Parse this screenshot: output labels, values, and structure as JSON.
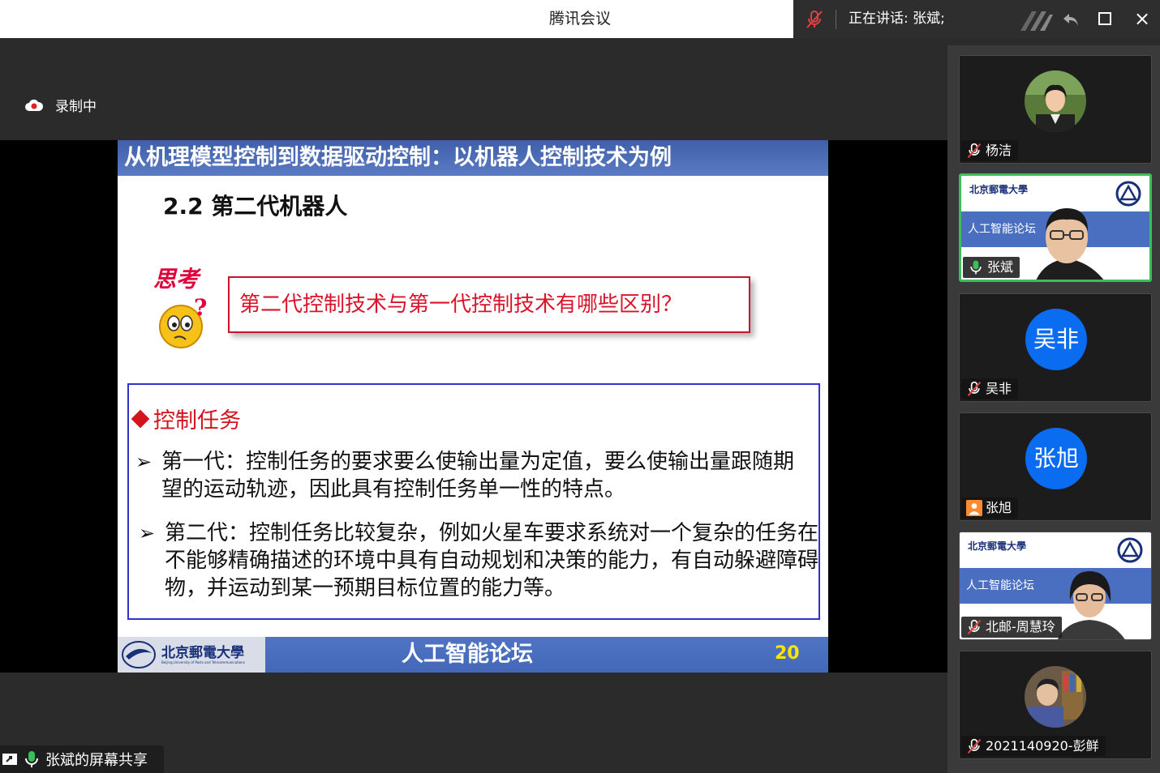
{
  "window": {
    "app_title": "腾讯会议",
    "speaking_label": "正在讲话: 张斌;"
  },
  "recording": {
    "label": "录制中"
  },
  "slide": {
    "header": "从机理模型控制到数据驱动控制：以机器人控制技术为例",
    "section": "2.2 第二代机器人",
    "think_label": "思考",
    "question": "第二代控制技术与第一代控制技术有哪些区别？",
    "task_title": "控制任务",
    "bullet1": "第一代：控制任务的要求要么使输出量为定值，要么使输出量跟随期望的运动轨迹，因此具有控制任务单一性的特点。",
    "bullet2": "第二代：控制任务比较复杂，例如火星车要求系统对一个复杂的任务在不能够精确描述的环境中具有自动规划和决策的能力，有自动躲避障碍物，并运动到某一预期目标位置的能力等。",
    "footer_logo": "北京郵電大學",
    "footer_logo_en": "Beijing University of Posts and Telecommunications",
    "footer_title": "人工智能论坛",
    "page_number": "20"
  },
  "share_badge": {
    "label": "张斌的屏幕共享"
  },
  "participants": [
    {
      "name": "杨洁",
      "type": "photo",
      "mic": "muted"
    },
    {
      "name": "张斌",
      "type": "camera",
      "mic": "active",
      "band_text": "人工智能论坛",
      "logo": "北京郵電大學"
    },
    {
      "name": "吴非",
      "type": "initials",
      "initials": "吴非",
      "mic": "muted"
    },
    {
      "name": "张旭",
      "type": "initials",
      "initials": "张旭",
      "mic": "none"
    },
    {
      "name": "北邮-周慧玲",
      "type": "camera",
      "mic": "muted",
      "band_text": "人工智能论坛",
      "logo": "北京郵電大學"
    },
    {
      "name": "2021140920-彭鲜",
      "type": "photo",
      "mic": "muted"
    }
  ],
  "colors": {
    "accent_green": "#3bbf5b",
    "avatar_blue": "#0a6cf0",
    "slide_header_blue": "#4a6cbb",
    "question_red": "#d9142a"
  }
}
